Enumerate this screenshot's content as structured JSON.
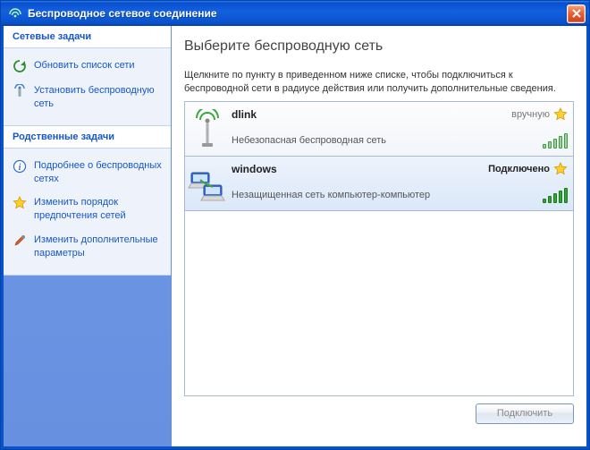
{
  "window": {
    "title": "Беспроводное сетевое соединение"
  },
  "sidebar": {
    "groups": [
      {
        "header": "Сетевые задачи",
        "items": [
          {
            "label": "Обновить список сети",
            "icon": "refresh-icon"
          },
          {
            "label": "Установить беспроводную сеть",
            "icon": "setup-wireless-icon"
          }
        ]
      },
      {
        "header": "Родственные задачи",
        "items": [
          {
            "label": "Подробнее о беспроводных сетях",
            "icon": "info-icon"
          },
          {
            "label": "Изменить порядок предпочтения сетей",
            "icon": "star-icon"
          },
          {
            "label": "Изменить дополнительные параметры",
            "icon": "settings-icon"
          }
        ]
      }
    ]
  },
  "main": {
    "title": "Выберите беспроводную сеть",
    "description": "Щелкните по пункту в приведенном ниже списке, чтобы подключиться к беспроводной сети в радиусе действия или получить дополнительные сведения.",
    "networks": [
      {
        "name": "dlink",
        "status": "вручную",
        "status_kind": "manual",
        "desc": "Небезопасная беспроводная сеть",
        "icon": "antenna-icon",
        "signal": "weak",
        "favorite": true
      },
      {
        "name": "windows",
        "status": "Подключено",
        "status_kind": "connected",
        "desc": "Незащищенная сеть компьютер-компьютер",
        "icon": "adhoc-icon",
        "signal": "strong",
        "favorite": true,
        "selected": true
      }
    ],
    "connect_button": "Подключить"
  }
}
